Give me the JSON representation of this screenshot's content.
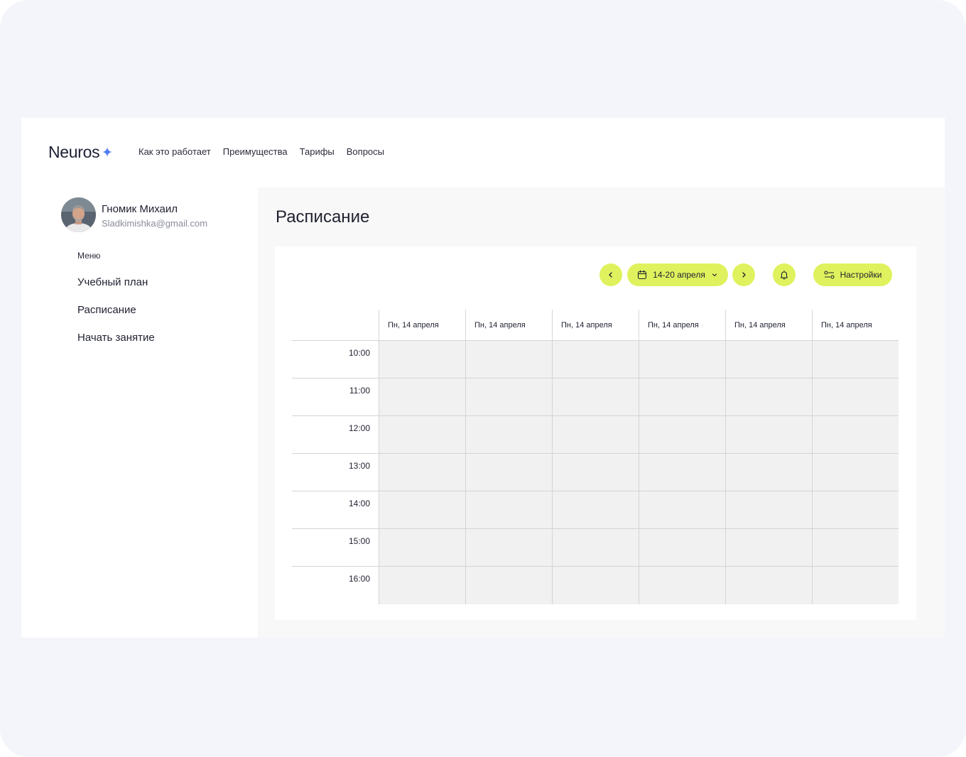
{
  "brand": {
    "name": "Neuros"
  },
  "nav": [
    "Как это работает",
    "Преимущества",
    "Тарифы",
    "Вопросы"
  ],
  "user": {
    "name": "Гномик Михаил",
    "email": "Sladkimishka@gmail.com"
  },
  "sidebar": {
    "menu_title": "Меню",
    "items": [
      "Учебный план",
      "Расписание",
      "Начать занятие"
    ]
  },
  "schedule": {
    "title": "Расписание",
    "week_label": "14-20 апреля",
    "settings_label": "Настройки",
    "days": [
      "Пн, 14 апреля",
      "Пн, 14 апреля",
      "Пн, 14 апреля",
      "Пн, 14 апреля",
      "Пн, 14 апреля",
      "Пн, 14 апреля"
    ],
    "times": [
      "10:00",
      "11:00",
      "12:00",
      "13:00",
      "14:00",
      "15:00",
      "16:00"
    ]
  },
  "colors": {
    "accent": "#dff25d",
    "brand_star": "#4f7cf6",
    "cell_bg": "#f1f1f1"
  }
}
